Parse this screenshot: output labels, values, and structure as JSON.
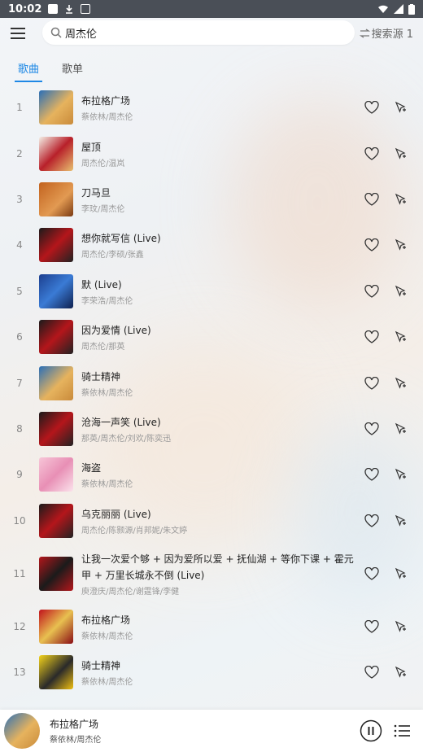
{
  "status": {
    "time": "10:02"
  },
  "search": {
    "value": "周杰伦",
    "source_label": "搜索源 1"
  },
  "tabs": [
    {
      "label": "歌曲",
      "active": true
    },
    {
      "label": "歌单",
      "active": false
    }
  ],
  "songs": [
    {
      "index": "1",
      "title": "布拉格广场",
      "artist": "蔡依林/周杰伦"
    },
    {
      "index": "2",
      "title": "屋顶",
      "artist": "周杰伦/温岚"
    },
    {
      "index": "3",
      "title": "刀马旦",
      "artist": "李玟/周杰伦"
    },
    {
      "index": "4",
      "title": "想你就写信 (Live)",
      "artist": "周杰伦/李硕/张鑫"
    },
    {
      "index": "5",
      "title": "默 (Live)",
      "artist": "李荣浩/周杰伦"
    },
    {
      "index": "6",
      "title": "因为爱情 (Live)",
      "artist": "周杰伦/那英"
    },
    {
      "index": "7",
      "title": "骑士精神",
      "artist": "蔡依林/周杰伦"
    },
    {
      "index": "8",
      "title": "沧海一声笑 (Live)",
      "artist": "那英/周杰伦/刘欢/陈奕迅"
    },
    {
      "index": "9",
      "title": "海盗",
      "artist": "蔡依林/周杰伦"
    },
    {
      "index": "10",
      "title": "乌克丽丽 (Live)",
      "artist": "周杰伦/陈颢源/肖邦妮/朱文婷"
    },
    {
      "index": "11",
      "title": "让我一次爱个够 + 因为爱所以爱 + 抚仙湖 + 等你下课 + 霍元甲 + 万里长城永不倒 (Live)",
      "artist": "庾澄庆/周杰伦/谢霆锋/李健"
    },
    {
      "index": "12",
      "title": "布拉格广场",
      "artist": "蔡依林/周杰伦"
    },
    {
      "index": "13",
      "title": "骑士精神",
      "artist": "蔡依林/周杰伦"
    }
  ],
  "player": {
    "title": "布拉格广场",
    "artist": "蔡依林/周杰伦"
  },
  "colors": {
    "accent": "#1e88e5"
  }
}
